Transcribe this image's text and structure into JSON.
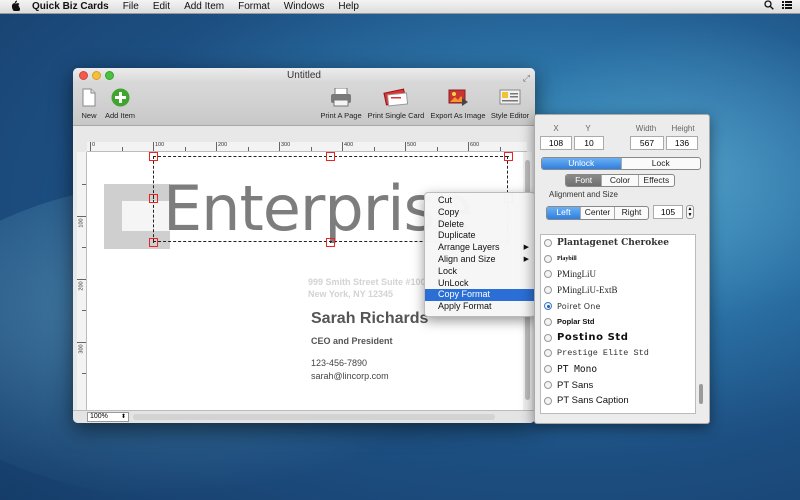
{
  "menubar": {
    "app_name": "Quick Biz Cards",
    "items": [
      "File",
      "Edit",
      "Add Item",
      "Format",
      "Windows",
      "Help"
    ]
  },
  "window": {
    "title": "Untitled"
  },
  "toolbar": {
    "new_label": "New",
    "add_item_label": "Add Item",
    "print_page_label": "Print A Page",
    "print_single_label": "Print Single Card",
    "export_label": "Export As Image",
    "style_editor_label": "Style Editor"
  },
  "ruler": {
    "h_labels": [
      "0",
      "100",
      "200",
      "300",
      "400",
      "500",
      "600"
    ],
    "v_labels": [
      "100",
      "200",
      "300"
    ]
  },
  "card": {
    "logo_text": "Enterprise",
    "address_line1": "999 Smith Street Suite #100",
    "address_line2": "New York, NY 12345",
    "name": "Sarah Richards",
    "role": "CEO and President",
    "phone": "123-456-7890",
    "email": "sarah@lincorp.com"
  },
  "zoom": {
    "value": "100%"
  },
  "context_menu": {
    "items": [
      "Cut",
      "Copy",
      "Delete",
      "Duplicate",
      "Arrange Layers",
      "Align and Size",
      "Lock",
      "UnLock",
      "Copy Format",
      "Apply Format"
    ],
    "submenu_items": [
      "Arrange Layers",
      "Align and Size"
    ],
    "highlighted": "Copy Format"
  },
  "inspector": {
    "x_label": "X",
    "y_label": "Y",
    "width_label": "Width",
    "height_label": "Height",
    "x": "108",
    "y": "10",
    "width": "567",
    "height": "136",
    "lock_tabs": [
      "Unlock",
      "Lock"
    ],
    "lock_selected": "Unlock",
    "style_tabs": [
      "Font",
      "Color",
      "Effects"
    ],
    "style_selected": "Font",
    "align_section_label": "Alignment and Size",
    "align_tabs": [
      "Left",
      "Center",
      "Right"
    ],
    "align_selected": "Left",
    "size": "105",
    "fonts": [
      "Plantagenet Cherokee",
      "Playbill",
      "PMingLiU",
      "PMingLiU-ExtB",
      "Poiret One",
      "Poplar Std",
      "Postino Std",
      "Prestige Elite Std",
      "PT Mono",
      "PT Sans",
      "PT Sans Caption"
    ],
    "selected_font": "Poiret One"
  },
  "colors": {
    "selection_highlight": "#2b6fd6",
    "handle_red": "#e22222"
  }
}
